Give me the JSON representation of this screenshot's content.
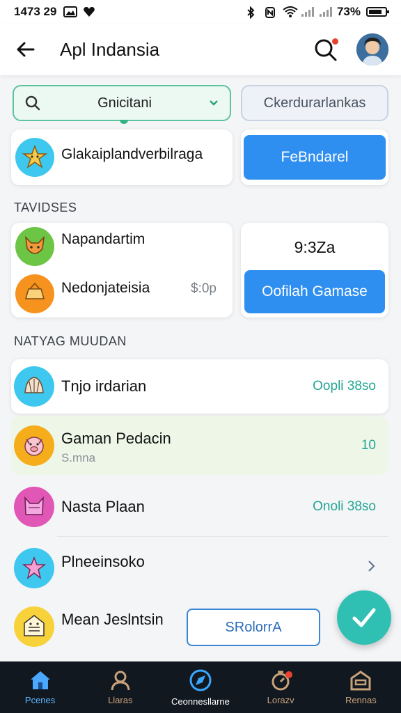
{
  "status_bar": {
    "time": "1473 29",
    "battery": "73%"
  },
  "header": {
    "title": "Apl Indansia"
  },
  "filters": {
    "select_value": "Gnicitani",
    "chip_label": "Ckerdurarlankas"
  },
  "promo_card": {
    "title": "Glakaiplandverbilraga",
    "button_label": "FeBndarel"
  },
  "section_1": {
    "label": "TAVIDSES"
  },
  "items_card": {
    "items": [
      {
        "title": "Napandartim"
      },
      {
        "title": "Nedonjateisia",
        "value": "$:0p"
      }
    ]
  },
  "time_card": {
    "time": "9:3Za",
    "button_label": "Oofilah Gamase"
  },
  "section_2": {
    "label": "NATYAG MUUDAN"
  },
  "list": [
    {
      "title": "Tnjo irdarian",
      "meta": "Oopli 38so"
    },
    {
      "title": "Gaman Pedacin",
      "subtitle": "S.mna",
      "meta": "10"
    },
    {
      "title": "Nasta Plaan",
      "meta": "Onoli 38so"
    },
    {
      "title": "Plneeinsoko",
      "meta": ""
    },
    {
      "title": "Mean Jeslntsin",
      "meta": ""
    }
  ],
  "outline_button": {
    "label": "SRolorrA"
  },
  "bottom_nav": [
    {
      "label": "Pcenes",
      "icon": "home-icon"
    },
    {
      "label": "Llaras",
      "icon": "person-icon"
    },
    {
      "label": "Ceonnesllarne",
      "icon": "compass-icon"
    },
    {
      "label": "Lorazv",
      "icon": "timer-icon"
    },
    {
      "label": "Rennas",
      "icon": "store-icon"
    }
  ],
  "colors": {
    "accent_blue": "#2f8ff0",
    "accent_teal": "#30c0b3",
    "list_meta": "#22a593",
    "nav_bg": "#121820"
  }
}
